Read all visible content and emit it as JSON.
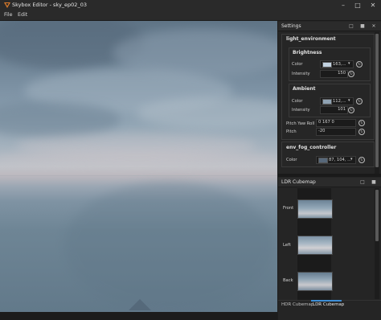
{
  "window": {
    "title": "Skybox Editor - sky_ep02_03",
    "minimize_icon": "–",
    "maximize_icon": "□",
    "close_icon": "✕"
  },
  "menu": {
    "items": [
      "File",
      "Edit"
    ]
  },
  "settings_panel": {
    "title": "Settings",
    "light_environment": {
      "title": "light_environment",
      "brightness": {
        "title": "Brightness",
        "color_label": "Color",
        "color_value": "163,...",
        "color_hex": "#c3d3e1",
        "intensity_label": "Intensity",
        "intensity_value": "150"
      },
      "ambient": {
        "title": "Ambient",
        "color_label": "Color",
        "color_value": "112,...",
        "color_hex": "#8fa2b3",
        "intensity_label": "Intensity",
        "intensity_value": "101"
      },
      "pitch_yaw_roll_label": "Pitch Yaw Roll",
      "pitch_yaw_roll_value": "0 167 0",
      "pitch_label": "Pitch",
      "pitch_value": "-20"
    },
    "env_fog_controller": {
      "title": "env_fog_controller",
      "color_label": "Color",
      "color_value": "87, 104, ...",
      "color_hex": "#57687a"
    }
  },
  "cubemap_panel": {
    "title": "LDR Cubemap",
    "faces": [
      {
        "label": "Front"
      },
      {
        "label": "Left"
      },
      {
        "label": "Back"
      }
    ],
    "tabs": [
      {
        "label": "HDR Cubemap",
        "active": false
      },
      {
        "label": "LDR Cubemap",
        "active": true
      }
    ]
  },
  "colors": {
    "accent": "#3d8ed6",
    "app_icon": "#d97a2b"
  },
  "icons": {
    "app": "app-icon",
    "panel_float": "float-icon",
    "panel_pin": "pin-icon",
    "panel_close": "close-icon",
    "reset": "reset-icon",
    "dropdown": "chevron-down-icon"
  }
}
